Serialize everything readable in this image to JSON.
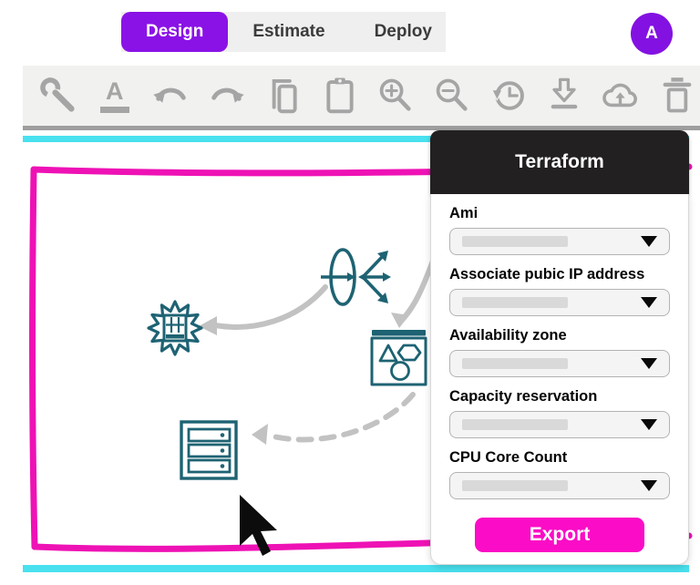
{
  "header": {
    "tabs": [
      {
        "label": "Design",
        "active": true
      },
      {
        "label": "Estimate",
        "active": false
      },
      {
        "label": "Deploy",
        "active": false
      }
    ],
    "avatar_text": "A"
  },
  "toolbar": {
    "font_icon_label": "A",
    "icons": [
      "wrench-icon",
      "font-color-icon",
      "undo-icon",
      "redo-icon",
      "copy-icon",
      "paste-icon",
      "zoom-in-icon",
      "zoom-out-icon",
      "history-icon",
      "download-icon",
      "cloud-upload-icon",
      "trash-icon"
    ]
  },
  "canvas": {
    "nodes": [
      "load-balancer-node",
      "burst-instance-node",
      "shapes-box-node",
      "server-stack-node"
    ],
    "connections": [
      {
        "from": "load-balancer-node",
        "to": "burst-instance-node",
        "style": "solid"
      },
      {
        "from": "load-balancer-node",
        "to": "shapes-box-node",
        "style": "solid"
      },
      {
        "from": "shapes-box-node",
        "to": "server-stack-node",
        "style": "dashed"
      }
    ]
  },
  "panel": {
    "title": "Terraform",
    "fields": [
      {
        "label": "Ami"
      },
      {
        "label": "Associate pubic IP address"
      },
      {
        "label": "Availability zone"
      },
      {
        "label": "Capacity reservation"
      },
      {
        "label": "CPU Core Count"
      }
    ],
    "export_label": "Export"
  },
  "colors": {
    "accent_purple": "#8a12e6",
    "magenta_border": "#ee12b5",
    "export_magenta": "#fb0cc6",
    "cyan_rule": "#49e1ef",
    "node_teal": "#1e6373",
    "toolbar_gray": "#a5a5a5",
    "arrow_gray": "#c2c2c2",
    "panel_header_black": "#232021"
  }
}
